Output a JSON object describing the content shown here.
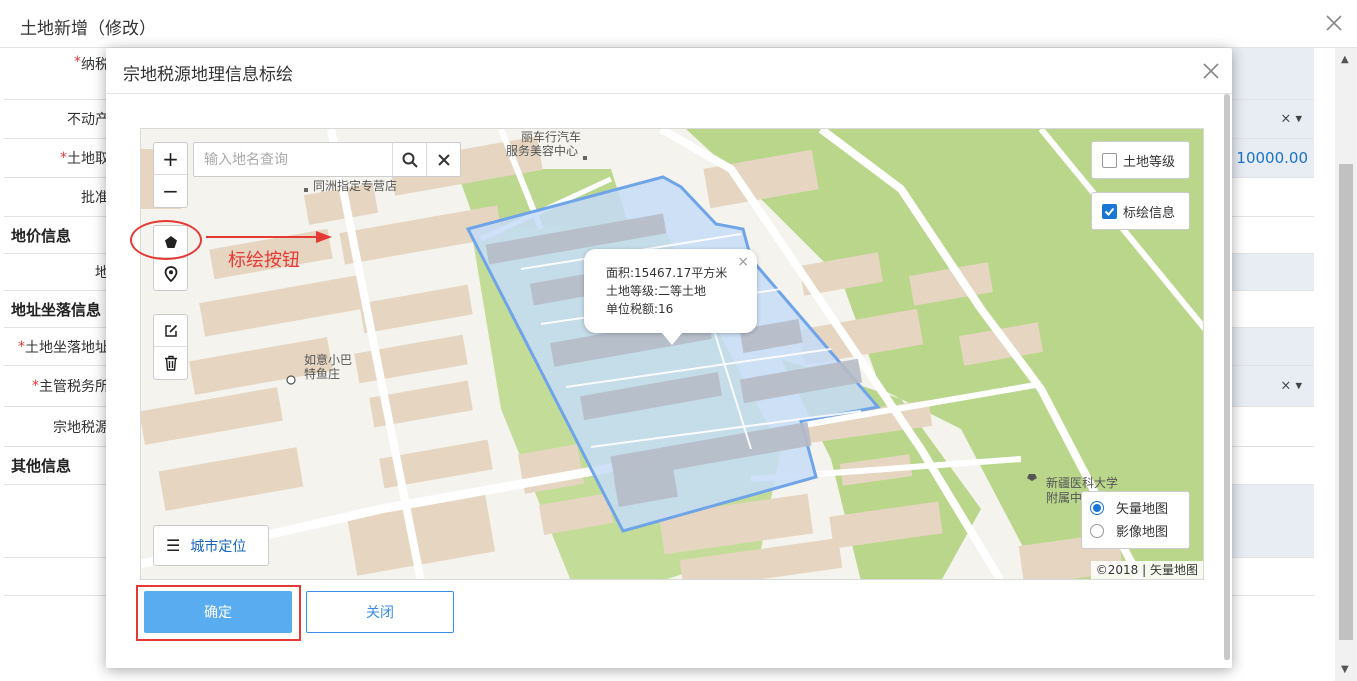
{
  "outer": {
    "title": "土地新增（修改）",
    "rows": [
      {
        "label": "纳税",
        "required": true
      },
      {
        "label": "不动产",
        "required": false,
        "has_select": true
      },
      {
        "label": "土地取",
        "required": true,
        "value": "10000.00"
      },
      {
        "label": "批准",
        "required": false
      },
      {
        "section": "地价信息"
      },
      {
        "label": "地",
        "required": false
      },
      {
        "section": "地址坐落信息"
      },
      {
        "label": "土地坐落地址",
        "required": true
      },
      {
        "label": "主管税务所",
        "required": true,
        "has_select": true
      },
      {
        "label": "宗地税源",
        "required": false
      },
      {
        "section": "其他信息"
      }
    ],
    "select_clear": "×",
    "select_caret": "▾"
  },
  "modal": {
    "title": "宗地税源地理信息标绘",
    "search": {
      "placeholder": "输入地名查询"
    },
    "zoom_in": "+",
    "zoom_out": "−",
    "annotation": "标绘按钮",
    "layers": [
      {
        "label": "土地等级",
        "checked": false
      },
      {
        "label": "标绘信息",
        "checked": true
      }
    ],
    "map_types": [
      {
        "label": "矢量地图",
        "selected": true
      },
      {
        "label": "影像地图",
        "selected": false
      }
    ],
    "city_locate": "城市定位",
    "copyright": "©2018 | 矢量地图",
    "popup": {
      "area": "面积:15467.17平方米",
      "grade": "土地等级:二等土地",
      "tax": "单位税额:16",
      "close": "×"
    },
    "poi": {
      "p1_line1": "丽车行汽车",
      "p1_line2": "服务美容中心",
      "p2": "同洲指定专营店",
      "p3_line1": "如意小巴",
      "p3_line2": "特鱼庄",
      "p4_line1": "新疆医科大学",
      "p4_line2": "附属中"
    },
    "buttons": {
      "ok": "确定",
      "close": "关闭"
    }
  },
  "colors": {
    "accent": "#5aacf0",
    "annotation": "#e53935",
    "parcel_fill": "#c6dcf7",
    "parcel_stroke": "#6fa4e8"
  }
}
